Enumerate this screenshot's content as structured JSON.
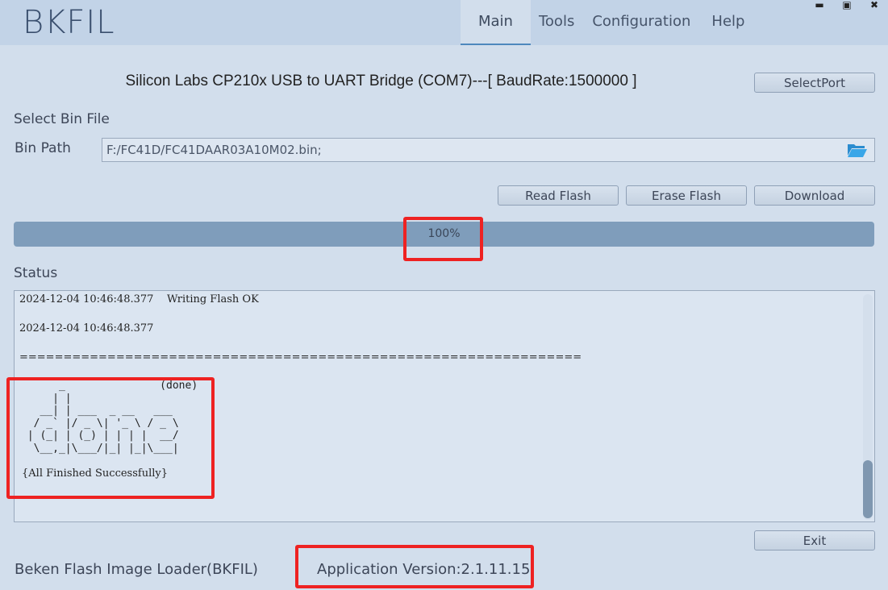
{
  "app": {
    "title": "BKFIL"
  },
  "nav": {
    "tabs": [
      "Main",
      "Tools",
      "Configuration",
      "Help"
    ],
    "active": "Main"
  },
  "window_controls": {
    "minimize": "▬",
    "maximize": "▣",
    "close": "✖"
  },
  "device": {
    "text": "Silicon Labs CP210x USB to UART Bridge (COM7)---[ BaudRate:1500000 ]"
  },
  "buttons": {
    "select_port": "SelectPort",
    "read_flash": "Read Flash",
    "erase_flash": "Erase Flash",
    "download": "Download",
    "exit": "Exit"
  },
  "bin": {
    "section_label": "Select Bin File",
    "path_label": "Bin Path",
    "path_value": "F:/FC41D/FC41DAAR03A10M02.bin;",
    "browse_icon": "folder-open-icon"
  },
  "progress": {
    "value": 1.0,
    "label": "100%"
  },
  "status": {
    "label": "Status",
    "log_lines": [
      "2024-12-04 10:46:48.377    Writing Flash OK",
      "",
      "2024-12-04 10:46:48.377",
      "",
      "================================================================"
    ],
    "ascii_art": "      _               (done)\n     | |\n   __| | ___  _ __   ___\n  / _` |/ _ \\| '_ \\ / _ \\\n | (_| | (_) | | | |  __/\n  \\__,_|\\___/|_| |_|\\___|",
    "ascii_footer": "{All Finished Successfully}"
  },
  "footer": {
    "app_name": "Beken Flash Image Loader(BKFIL)",
    "version": "Application Version:2.1.11.15"
  },
  "colors": {
    "highlight": "#ee2222",
    "accent": "#4e88bd",
    "progress_fill": "#7f9dbb"
  }
}
